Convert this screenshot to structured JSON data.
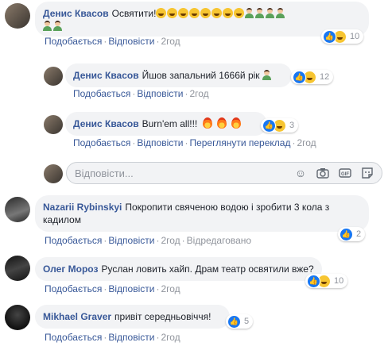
{
  "actions": {
    "like": "Подобається",
    "reply": "Відповісти",
    "translate": "Переглянути переклад",
    "edited": "Відредаговано"
  },
  "comments": [
    {
      "author": "Денис Квасов",
      "text": "Освятити!",
      "time": "2год",
      "reactions": "10"
    },
    {
      "author": "Денис Квасов",
      "text": "Йшов запальний 1666й рік",
      "time": "2год",
      "reactions": "12"
    },
    {
      "author": "Денис Квасов",
      "text": "Burn'em all!!!",
      "time": "2год",
      "reactions": "3"
    },
    {
      "author": "Nazarii Rybinskyi",
      "text": "Покропити свяченою водою і зробити 3 кола з кадилом",
      "time": "2год",
      "reactions": "2"
    },
    {
      "author": "Олег Мороз",
      "text": "Руслан ловить хайп. Драм театр освятили вже?",
      "time": "2год",
      "reactions": "10"
    },
    {
      "author": "Mikhael Graver",
      "text": "привіт середньовіччя!",
      "time": "2год",
      "reactions": "5"
    }
  ],
  "reply_box": {
    "placeholder": "Відповісти..."
  },
  "icons": [
    "smiley-icon",
    "camera-icon",
    "gif-icon",
    "sticker-icon",
    "like-reaction-icon",
    "haha-reaction-icon"
  ],
  "colors": {
    "link": "#385898",
    "bubble": "#f2f3f5",
    "like": "#1877f2"
  }
}
